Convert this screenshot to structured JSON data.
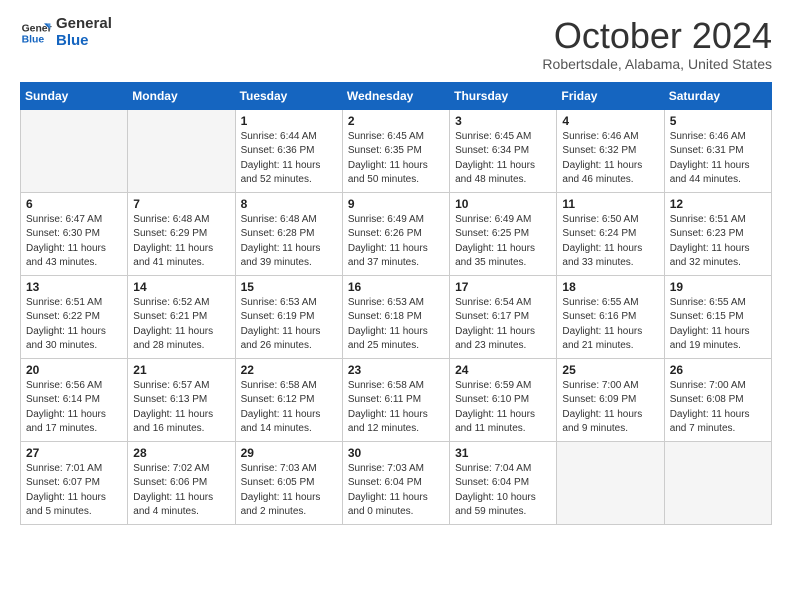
{
  "logo": {
    "line1": "General",
    "line2": "Blue"
  },
  "title": "October 2024",
  "location": "Robertsdale, Alabama, United States",
  "weekdays": [
    "Sunday",
    "Monday",
    "Tuesday",
    "Wednesday",
    "Thursday",
    "Friday",
    "Saturday"
  ],
  "weeks": [
    [
      {
        "day": "",
        "info": ""
      },
      {
        "day": "",
        "info": ""
      },
      {
        "day": "1",
        "info": "Sunrise: 6:44 AM\nSunset: 6:36 PM\nDaylight: 11 hours\nand 52 minutes."
      },
      {
        "day": "2",
        "info": "Sunrise: 6:45 AM\nSunset: 6:35 PM\nDaylight: 11 hours\nand 50 minutes."
      },
      {
        "day": "3",
        "info": "Sunrise: 6:45 AM\nSunset: 6:34 PM\nDaylight: 11 hours\nand 48 minutes."
      },
      {
        "day": "4",
        "info": "Sunrise: 6:46 AM\nSunset: 6:32 PM\nDaylight: 11 hours\nand 46 minutes."
      },
      {
        "day": "5",
        "info": "Sunrise: 6:46 AM\nSunset: 6:31 PM\nDaylight: 11 hours\nand 44 minutes."
      }
    ],
    [
      {
        "day": "6",
        "info": "Sunrise: 6:47 AM\nSunset: 6:30 PM\nDaylight: 11 hours\nand 43 minutes."
      },
      {
        "day": "7",
        "info": "Sunrise: 6:48 AM\nSunset: 6:29 PM\nDaylight: 11 hours\nand 41 minutes."
      },
      {
        "day": "8",
        "info": "Sunrise: 6:48 AM\nSunset: 6:28 PM\nDaylight: 11 hours\nand 39 minutes."
      },
      {
        "day": "9",
        "info": "Sunrise: 6:49 AM\nSunset: 6:26 PM\nDaylight: 11 hours\nand 37 minutes."
      },
      {
        "day": "10",
        "info": "Sunrise: 6:49 AM\nSunset: 6:25 PM\nDaylight: 11 hours\nand 35 minutes."
      },
      {
        "day": "11",
        "info": "Sunrise: 6:50 AM\nSunset: 6:24 PM\nDaylight: 11 hours\nand 33 minutes."
      },
      {
        "day": "12",
        "info": "Sunrise: 6:51 AM\nSunset: 6:23 PM\nDaylight: 11 hours\nand 32 minutes."
      }
    ],
    [
      {
        "day": "13",
        "info": "Sunrise: 6:51 AM\nSunset: 6:22 PM\nDaylight: 11 hours\nand 30 minutes."
      },
      {
        "day": "14",
        "info": "Sunrise: 6:52 AM\nSunset: 6:21 PM\nDaylight: 11 hours\nand 28 minutes."
      },
      {
        "day": "15",
        "info": "Sunrise: 6:53 AM\nSunset: 6:19 PM\nDaylight: 11 hours\nand 26 minutes."
      },
      {
        "day": "16",
        "info": "Sunrise: 6:53 AM\nSunset: 6:18 PM\nDaylight: 11 hours\nand 25 minutes."
      },
      {
        "day": "17",
        "info": "Sunrise: 6:54 AM\nSunset: 6:17 PM\nDaylight: 11 hours\nand 23 minutes."
      },
      {
        "day": "18",
        "info": "Sunrise: 6:55 AM\nSunset: 6:16 PM\nDaylight: 11 hours\nand 21 minutes."
      },
      {
        "day": "19",
        "info": "Sunrise: 6:55 AM\nSunset: 6:15 PM\nDaylight: 11 hours\nand 19 minutes."
      }
    ],
    [
      {
        "day": "20",
        "info": "Sunrise: 6:56 AM\nSunset: 6:14 PM\nDaylight: 11 hours\nand 17 minutes."
      },
      {
        "day": "21",
        "info": "Sunrise: 6:57 AM\nSunset: 6:13 PM\nDaylight: 11 hours\nand 16 minutes."
      },
      {
        "day": "22",
        "info": "Sunrise: 6:58 AM\nSunset: 6:12 PM\nDaylight: 11 hours\nand 14 minutes."
      },
      {
        "day": "23",
        "info": "Sunrise: 6:58 AM\nSunset: 6:11 PM\nDaylight: 11 hours\nand 12 minutes."
      },
      {
        "day": "24",
        "info": "Sunrise: 6:59 AM\nSunset: 6:10 PM\nDaylight: 11 hours\nand 11 minutes."
      },
      {
        "day": "25",
        "info": "Sunrise: 7:00 AM\nSunset: 6:09 PM\nDaylight: 11 hours\nand 9 minutes."
      },
      {
        "day": "26",
        "info": "Sunrise: 7:00 AM\nSunset: 6:08 PM\nDaylight: 11 hours\nand 7 minutes."
      }
    ],
    [
      {
        "day": "27",
        "info": "Sunrise: 7:01 AM\nSunset: 6:07 PM\nDaylight: 11 hours\nand 5 minutes."
      },
      {
        "day": "28",
        "info": "Sunrise: 7:02 AM\nSunset: 6:06 PM\nDaylight: 11 hours\nand 4 minutes."
      },
      {
        "day": "29",
        "info": "Sunrise: 7:03 AM\nSunset: 6:05 PM\nDaylight: 11 hours\nand 2 minutes."
      },
      {
        "day": "30",
        "info": "Sunrise: 7:03 AM\nSunset: 6:04 PM\nDaylight: 11 hours\nand 0 minutes."
      },
      {
        "day": "31",
        "info": "Sunrise: 7:04 AM\nSunset: 6:04 PM\nDaylight: 10 hours\nand 59 minutes."
      },
      {
        "day": "",
        "info": ""
      },
      {
        "day": "",
        "info": ""
      }
    ]
  ]
}
